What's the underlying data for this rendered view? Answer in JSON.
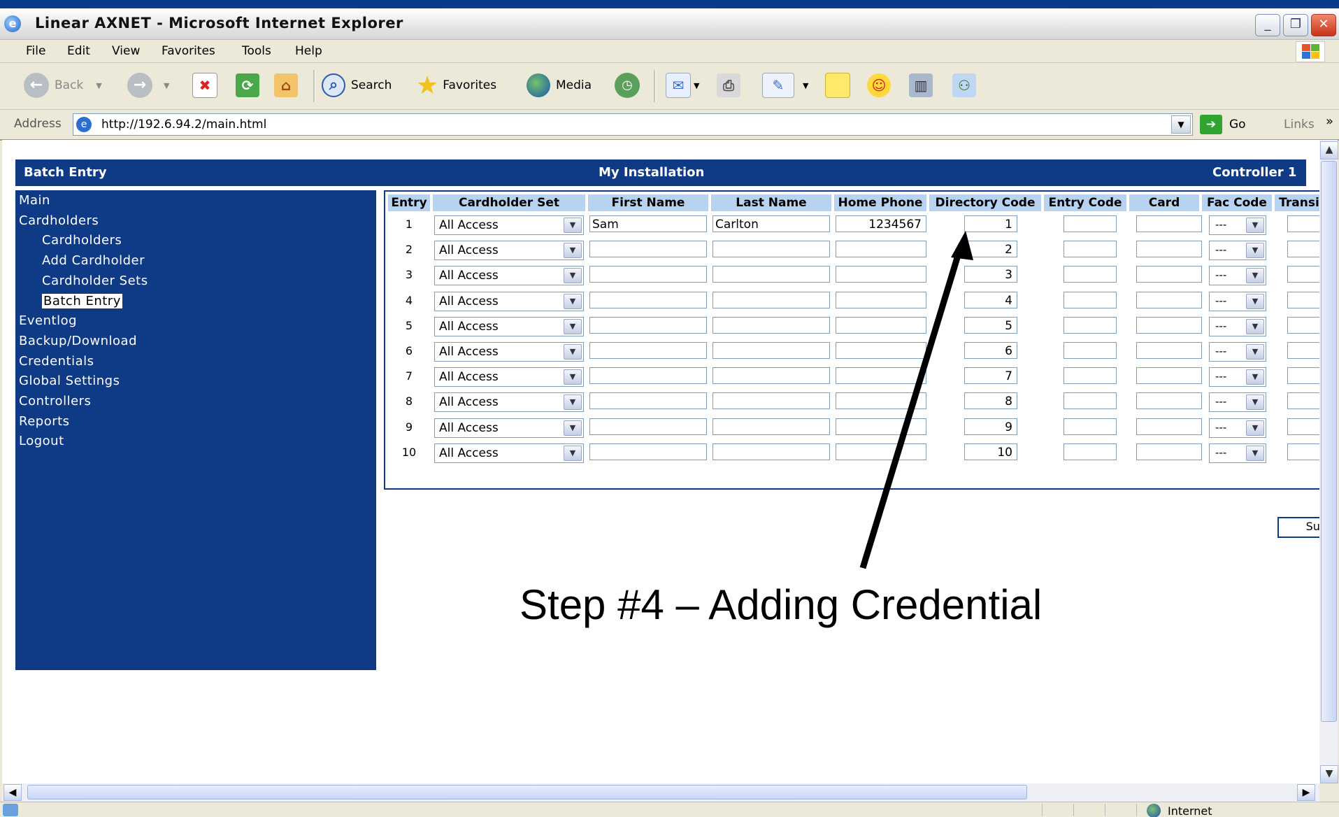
{
  "window": {
    "title": "Linear AXNET - Microsoft Internet Explorer"
  },
  "menu": [
    "File",
    "Edit",
    "View",
    "Favorites",
    "Tools",
    "Help"
  ],
  "toolbar": {
    "back": "Back",
    "search": "Search",
    "favorites": "Favorites",
    "media": "Media"
  },
  "address": {
    "label": "Address",
    "url": "http://192.6.94.2/main.html",
    "go": "Go",
    "links": "Links"
  },
  "header": {
    "left": "Batch Entry",
    "center": "My Installation",
    "right": "Controller 1"
  },
  "nav": [
    {
      "label": "Main",
      "sub": false,
      "selected": false
    },
    {
      "label": "Cardholders",
      "sub": false,
      "selected": false
    },
    {
      "label": "Cardholders",
      "sub": true,
      "selected": false
    },
    {
      "label": "Add Cardholder",
      "sub": true,
      "selected": false
    },
    {
      "label": "Cardholder Sets",
      "sub": true,
      "selected": false
    },
    {
      "label": "Batch Entry",
      "sub": true,
      "selected": true
    },
    {
      "label": "Eventlog",
      "sub": false,
      "selected": false
    },
    {
      "label": "Backup/Download",
      "sub": false,
      "selected": false
    },
    {
      "label": "Credentials",
      "sub": false,
      "selected": false
    },
    {
      "label": "Global Settings",
      "sub": false,
      "selected": false
    },
    {
      "label": "Controllers",
      "sub": false,
      "selected": false
    },
    {
      "label": "Reports",
      "sub": false,
      "selected": false
    },
    {
      "label": "Logout",
      "sub": false,
      "selected": false
    }
  ],
  "table": {
    "columns": [
      "Entry",
      "Cardholder Set",
      "First Name",
      "Last Name",
      "Home Phone",
      "Directory Code",
      "Entry Code",
      "Card",
      "Fac Code",
      "Transi"
    ],
    "rows": [
      {
        "entry": "1",
        "set": "All Access",
        "first": "Sam",
        "last": "Carlton",
        "phone": "1234567",
        "dir": "1",
        "entrycode": "",
        "card": "",
        "fac": "---"
      },
      {
        "entry": "2",
        "set": "All Access",
        "first": "",
        "last": "",
        "phone": "",
        "dir": "2",
        "entrycode": "",
        "card": "",
        "fac": "---"
      },
      {
        "entry": "3",
        "set": "All Access",
        "first": "",
        "last": "",
        "phone": "",
        "dir": "3",
        "entrycode": "",
        "card": "",
        "fac": "---"
      },
      {
        "entry": "4",
        "set": "All Access",
        "first": "",
        "last": "",
        "phone": "",
        "dir": "4",
        "entrycode": "",
        "card": "",
        "fac": "---"
      },
      {
        "entry": "5",
        "set": "All Access",
        "first": "",
        "last": "",
        "phone": "",
        "dir": "5",
        "entrycode": "",
        "card": "",
        "fac": "---"
      },
      {
        "entry": "6",
        "set": "All Access",
        "first": "",
        "last": "",
        "phone": "",
        "dir": "6",
        "entrycode": "",
        "card": "",
        "fac": "---"
      },
      {
        "entry": "7",
        "set": "All Access",
        "first": "",
        "last": "",
        "phone": "",
        "dir": "7",
        "entrycode": "",
        "card": "",
        "fac": "---"
      },
      {
        "entry": "8",
        "set": "All Access",
        "first": "",
        "last": "",
        "phone": "",
        "dir": "8",
        "entrycode": "",
        "card": "",
        "fac": "---"
      },
      {
        "entry": "9",
        "set": "All Access",
        "first": "",
        "last": "",
        "phone": "",
        "dir": "9",
        "entrycode": "",
        "card": "",
        "fac": "---"
      },
      {
        "entry": "10",
        "set": "All Access",
        "first": "",
        "last": "",
        "phone": "",
        "dir": "10",
        "entrycode": "",
        "card": "",
        "fac": "---"
      }
    ],
    "submit": "Submit"
  },
  "annotation": "Step #4 – Adding Credential",
  "status": {
    "zone": "Internet"
  },
  "colors": {
    "nav_bg": "#0e3a86",
    "col_header_bg": "#b8d3ef"
  }
}
